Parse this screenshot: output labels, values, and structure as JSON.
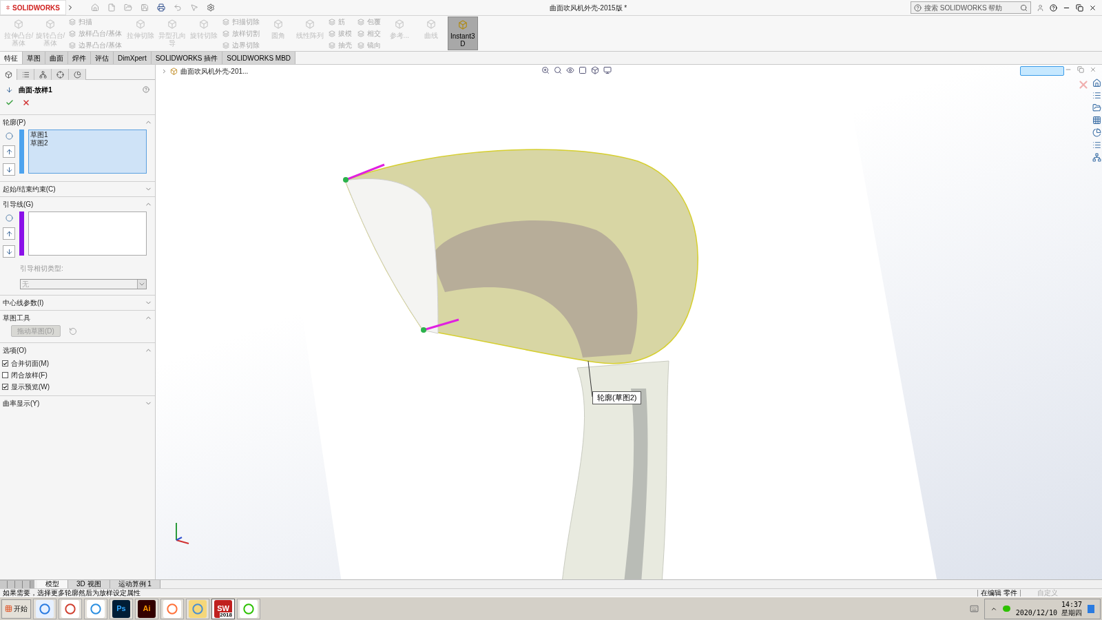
{
  "title_bar": {
    "logo": "SOLIDWORKS",
    "document_title": "曲面吹风机外壳-2015版 *",
    "search": {
      "placeholder": "搜索 SOLIDWORKS 帮助"
    }
  },
  "ribbon": [
    {
      "kind": "large",
      "label": "拉伸凸台/基体",
      "disabled": true,
      "selected": false
    },
    {
      "kind": "large",
      "label": "旋转凸台/基体",
      "disabled": true,
      "selected": false
    },
    {
      "kind": "stack",
      "items": [
        {
          "label": "扫描",
          "disabled": true
        },
        {
          "label": "放样凸台/基体",
          "disabled": true
        },
        {
          "label": "边界凸台/基体",
          "disabled": true
        }
      ]
    },
    {
      "kind": "large",
      "label": "拉伸切除",
      "disabled": true,
      "selected": false
    },
    {
      "kind": "large",
      "label": "异型孔向导",
      "disabled": true,
      "selected": false
    },
    {
      "kind": "large",
      "label": "旋转切除",
      "disabled": true,
      "selected": false
    },
    {
      "kind": "stack",
      "items": [
        {
          "label": "扫描切除",
          "disabled": true
        },
        {
          "label": "放样切割",
          "disabled": true
        },
        {
          "label": "边界切除",
          "disabled": true
        }
      ]
    },
    {
      "kind": "large",
      "label": "圆角",
      "disabled": true,
      "selected": false
    },
    {
      "kind": "large",
      "label": "线性阵列",
      "disabled": true,
      "selected": false
    },
    {
      "kind": "stack",
      "items": [
        {
          "label": "筋",
          "disabled": true
        },
        {
          "label": "拔模",
          "disabled": true
        },
        {
          "label": "抽壳",
          "disabled": true
        }
      ]
    },
    {
      "kind": "stack",
      "items": [
        {
          "label": "包覆",
          "disabled": true
        },
        {
          "label": "相交",
          "disabled": true
        },
        {
          "label": "镜向",
          "disabled": true
        }
      ]
    },
    {
      "kind": "large",
      "label": "参考...",
      "disabled": true,
      "selected": false
    },
    {
      "kind": "large",
      "label": "曲线",
      "disabled": true,
      "selected": false
    },
    {
      "kind": "large",
      "label": "Instant3D",
      "disabled": false,
      "selected": true
    }
  ],
  "command_tabs": [
    {
      "label": "特征",
      "selected": true
    },
    {
      "label": "草图",
      "selected": false
    },
    {
      "label": "曲面",
      "selected": false
    },
    {
      "label": "焊件",
      "selected": false
    },
    {
      "label": "评估",
      "selected": false
    },
    {
      "label": "DimXpert",
      "selected": false
    },
    {
      "label": "SOLIDWORKS 插件",
      "selected": false
    },
    {
      "label": "SOLIDWORKS MBD",
      "selected": false
    }
  ],
  "panel_tabs": [
    {
      "selected": true
    },
    {
      "selected": false
    },
    {
      "selected": false
    },
    {
      "selected": false
    },
    {
      "selected": false
    }
  ],
  "property_manager": {
    "title": "曲面-放样1",
    "sections": [
      {
        "kind": "list",
        "title": "轮廓(P)",
        "expanded": true,
        "color": "#4da3ee",
        "items": [
          "草图1",
          "草图2"
        ],
        "highlighted": true
      },
      {
        "title": "起始/结束约束(C)",
        "expanded": false
      },
      {
        "kind": "list",
        "title": "引导线(G)",
        "expanded": true,
        "color": "#8a10e8",
        "highlighted": false,
        "field_label": "引导相切类型:",
        "select_value": "无"
      },
      {
        "title": "中心线参数(I)",
        "expanded": false
      },
      {
        "kind": "tool",
        "title": "草图工具",
        "expanded": true,
        "button": "拖动草图(D)"
      },
      {
        "kind": "options",
        "title": "选项(O)",
        "expanded": true,
        "options": [
          {
            "label": "合并切面(M)",
            "checked": true
          },
          {
            "label": "闭合放样(F)",
            "checked": false
          },
          {
            "label": "显示预览(W)",
            "checked": true
          }
        ]
      },
      {
        "title": "曲率显示(Y)",
        "expanded": false
      }
    ]
  },
  "viewport": {
    "tree_root": "曲面吹风机外壳-201...",
    "callout": "轮廓(草图2)"
  },
  "bottom_tabs": [
    {
      "label": "模型",
      "selected": true
    },
    {
      "label": "3D 视图",
      "selected": false
    },
    {
      "label": "运动算例 1",
      "selected": false
    }
  ],
  "status_bar": {
    "message": "如果需要，选择更多轮廓然后为放样设定属性",
    "mode": "在编辑 零件",
    "units": "自定义"
  },
  "taskbar": {
    "start": "开始",
    "apps": [
      {
        "kind": "browser",
        "selected": false
      },
      {
        "kind": "chrome",
        "selected": false
      },
      {
        "kind": "cloud",
        "selected": false
      },
      {
        "kind": "ps",
        "label": "Ps",
        "selected": false
      },
      {
        "kind": "ai",
        "label": "Ai",
        "selected": false
      },
      {
        "kind": "firefox",
        "selected": false
      },
      {
        "kind": "folder",
        "selected": false
      },
      {
        "kind": "sw",
        "label": "SW",
        "badge": "2018",
        "selected": true
      },
      {
        "kind": "chat",
        "selected": false
      }
    ],
    "time": "14:37",
    "date": "2020/12/10 星期四"
  }
}
